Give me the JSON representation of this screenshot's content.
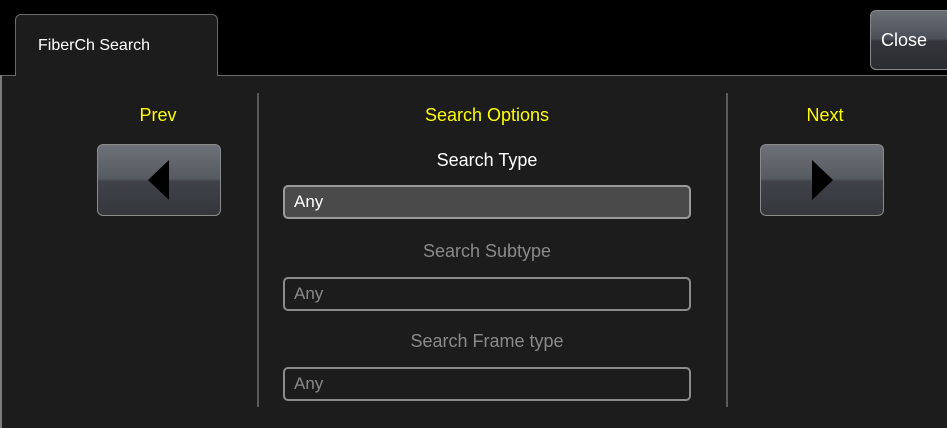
{
  "tab": {
    "title": "FiberCh Search"
  },
  "close_label": "Close",
  "prev": {
    "label": "Prev",
    "icon": "triangle-left-icon"
  },
  "next": {
    "label": "Next",
    "icon": "triangle-right-icon"
  },
  "options": {
    "heading": "Search Options",
    "search_type": {
      "label": "Search Type",
      "value": "Any"
    },
    "search_subtype": {
      "label": "Search Subtype",
      "value": "Any"
    },
    "search_frame_type": {
      "label": "Search Frame type",
      "value": "Any"
    }
  },
  "colors": {
    "accent": "#ffff00",
    "background": "#000000",
    "panel": "#1c1c1c"
  }
}
